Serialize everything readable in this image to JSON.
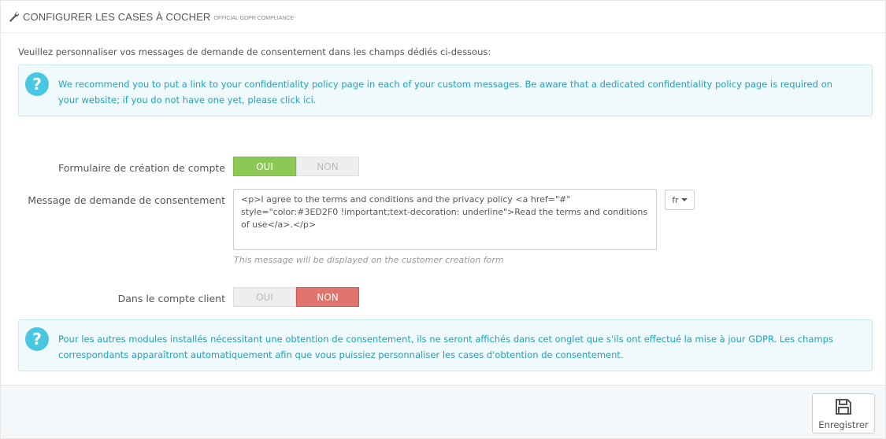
{
  "header": {
    "title": "Configurer les cases à cocher",
    "subtitle": "Official GDPR Compliance"
  },
  "intro": "Veuillez personnaliser vos messages de demande de consentement dans les champs dédiés ci-dessous:",
  "alert_top": "We recommend you to put a link to your confidentiality policy page in each of your custom messages. Be aware that a dedicated confidentiality policy page is required on your website; if you do not have one yet, please click ici.",
  "form": {
    "account_creation": {
      "label": "Formulaire de création de compte",
      "yes": "OUI",
      "no": "NON",
      "value": "yes"
    },
    "consent_message": {
      "label": "Message de demande de consentement",
      "value": "<p>I agree to the terms and conditions and the privacy policy <a href=\"#\" style=\"color:#3ED2F0 !important;text-decoration: underline\">Read the terms and conditions of use</a>.</p>",
      "lang": "fr",
      "help": "This message will be displayed on the customer creation form"
    },
    "customer_account": {
      "label": "Dans le compte client",
      "yes": "OUI",
      "no": "NON",
      "value": "no"
    }
  },
  "alert_bottom": "Pour les autres modules installés nécessitant une obtention de consentement, ils ne seront affichés dans cet onglet que s'ils ont effectué la mise à jour GDPR. Les champs correspondants apparaîtront automatiquement afin que vous puissiez personnaliser les cases d'obtention de consentement.",
  "footer": {
    "save_label": "Enregistrer"
  },
  "colors": {
    "green": "#8bc954",
    "red": "#e0736b",
    "info": "#1ea1bf"
  }
}
